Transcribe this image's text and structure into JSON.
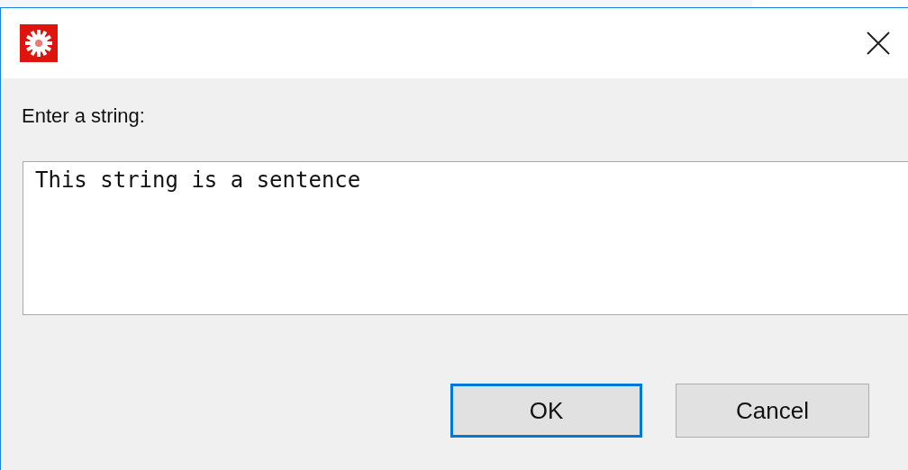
{
  "prompt": {
    "label": "Enter a string:",
    "value": "This string is a sentence"
  },
  "buttons": [
    {
      "label": "OK",
      "focused": true
    },
    {
      "label": "Cancel",
      "focused": false
    }
  ]
}
